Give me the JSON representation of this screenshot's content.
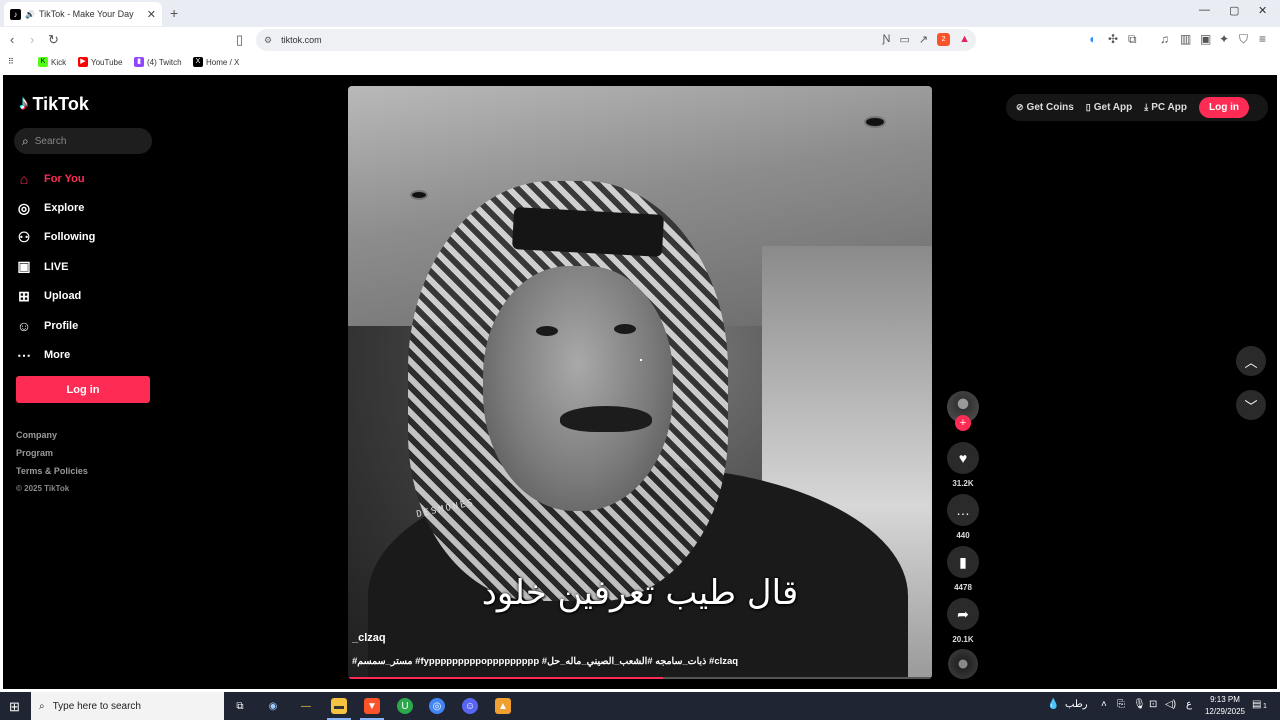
{
  "browser": {
    "tab_title": "TikTok - Make Your Day",
    "url": "tiktok.com",
    "bookmarks": [
      "Kick",
      "YouTube",
      "(4) Twitch",
      "Home / X"
    ],
    "brave_badge": "2"
  },
  "sidebar": {
    "logo_text": "TikTok",
    "search_placeholder": "Search",
    "items": [
      {
        "label": "For You",
        "icon": "home-icon"
      },
      {
        "label": "Explore",
        "icon": "compass-icon"
      },
      {
        "label": "Following",
        "icon": "user-plus-icon"
      },
      {
        "label": "LIVE",
        "icon": "live-icon"
      },
      {
        "label": "Upload",
        "icon": "upload-icon"
      },
      {
        "label": "Profile",
        "icon": "profile-icon"
      },
      {
        "label": "More",
        "icon": "more-icon"
      }
    ],
    "login_label": "Log in",
    "footer": [
      "Company",
      "Program",
      "Terms & Policies",
      "© 2025 TikTok"
    ]
  },
  "header": {
    "get_coins": "Get Coins",
    "get_app": "Get App",
    "pc_app": "PC App",
    "login_label": "Log in"
  },
  "video": {
    "caption_text": "قال طيب تعرفين خلود",
    "watermark": "DESMONES",
    "author": "_clzaq",
    "hashtags": "#مستر_سمسم #fypppppppppoppppppppp #ذبات_سامجه #الشعب_الصيني_ماله_حل #clzaq",
    "progress": 0.54
  },
  "actions": {
    "likes": "31.2K",
    "comments": "440",
    "saves": "4478",
    "shares": "20.1K"
  },
  "taskbar": {
    "search_placeholder": "Type here to search",
    "weather": "رطب",
    "lang": "ع",
    "time": "9:13 PM",
    "date": "12/29/2025",
    "notif_count": "1"
  },
  "colors": {
    "accent": "#fe2c55",
    "page_bg": "#000000"
  }
}
